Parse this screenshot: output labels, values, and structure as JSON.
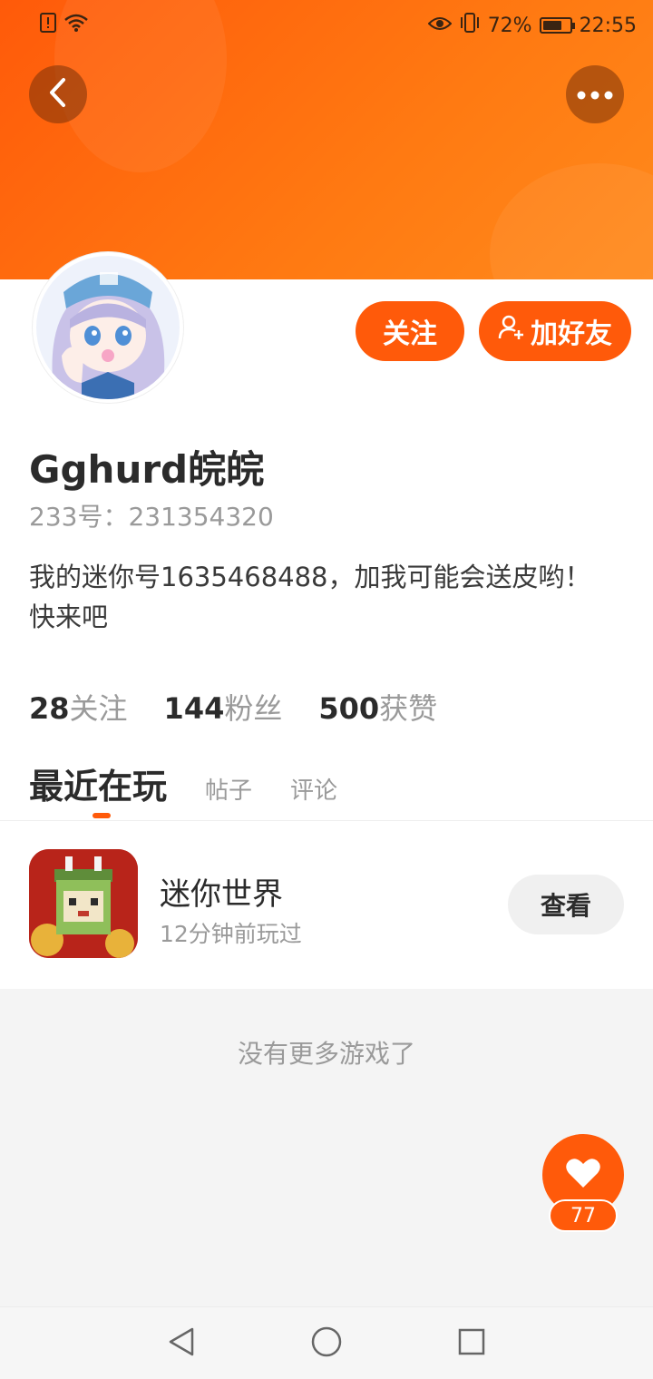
{
  "status_bar": {
    "battery_percent": "72%",
    "battery_level": 0.72,
    "time": "22:55",
    "icons": [
      "alert-icon",
      "wifi-icon",
      "eye-icon",
      "vibrate-icon",
      "battery-icon"
    ]
  },
  "header": {
    "back_icon": "chevron-left-icon",
    "more_icon": "more-dots-icon"
  },
  "profile": {
    "avatar": "anime-girl-avatar",
    "follow_label": "关注",
    "add_friend_label": "加好友",
    "username": "Gghurd皖皖",
    "id_label": "233号：",
    "id_value": "231354320",
    "bio": "我的迷你号1635468488，加我可能会送皮哟！快来吧"
  },
  "stats": [
    {
      "num": "28",
      "label": "关注"
    },
    {
      "num": "144",
      "label": "粉丝"
    },
    {
      "num": "500",
      "label": "获赞"
    }
  ],
  "tabs": {
    "active": "最近在玩",
    "posts": "帖子",
    "comments": "评论"
  },
  "games": [
    {
      "name": "迷你世界",
      "time": "12分钟前玩过",
      "button": "查看"
    }
  ],
  "no_more_text": "没有更多游戏了",
  "like": {
    "count": "77"
  },
  "colors": {
    "accent": "#ff5a0a",
    "text_dark": "#2b2b2b",
    "text_gray": "#9a9a9a"
  }
}
